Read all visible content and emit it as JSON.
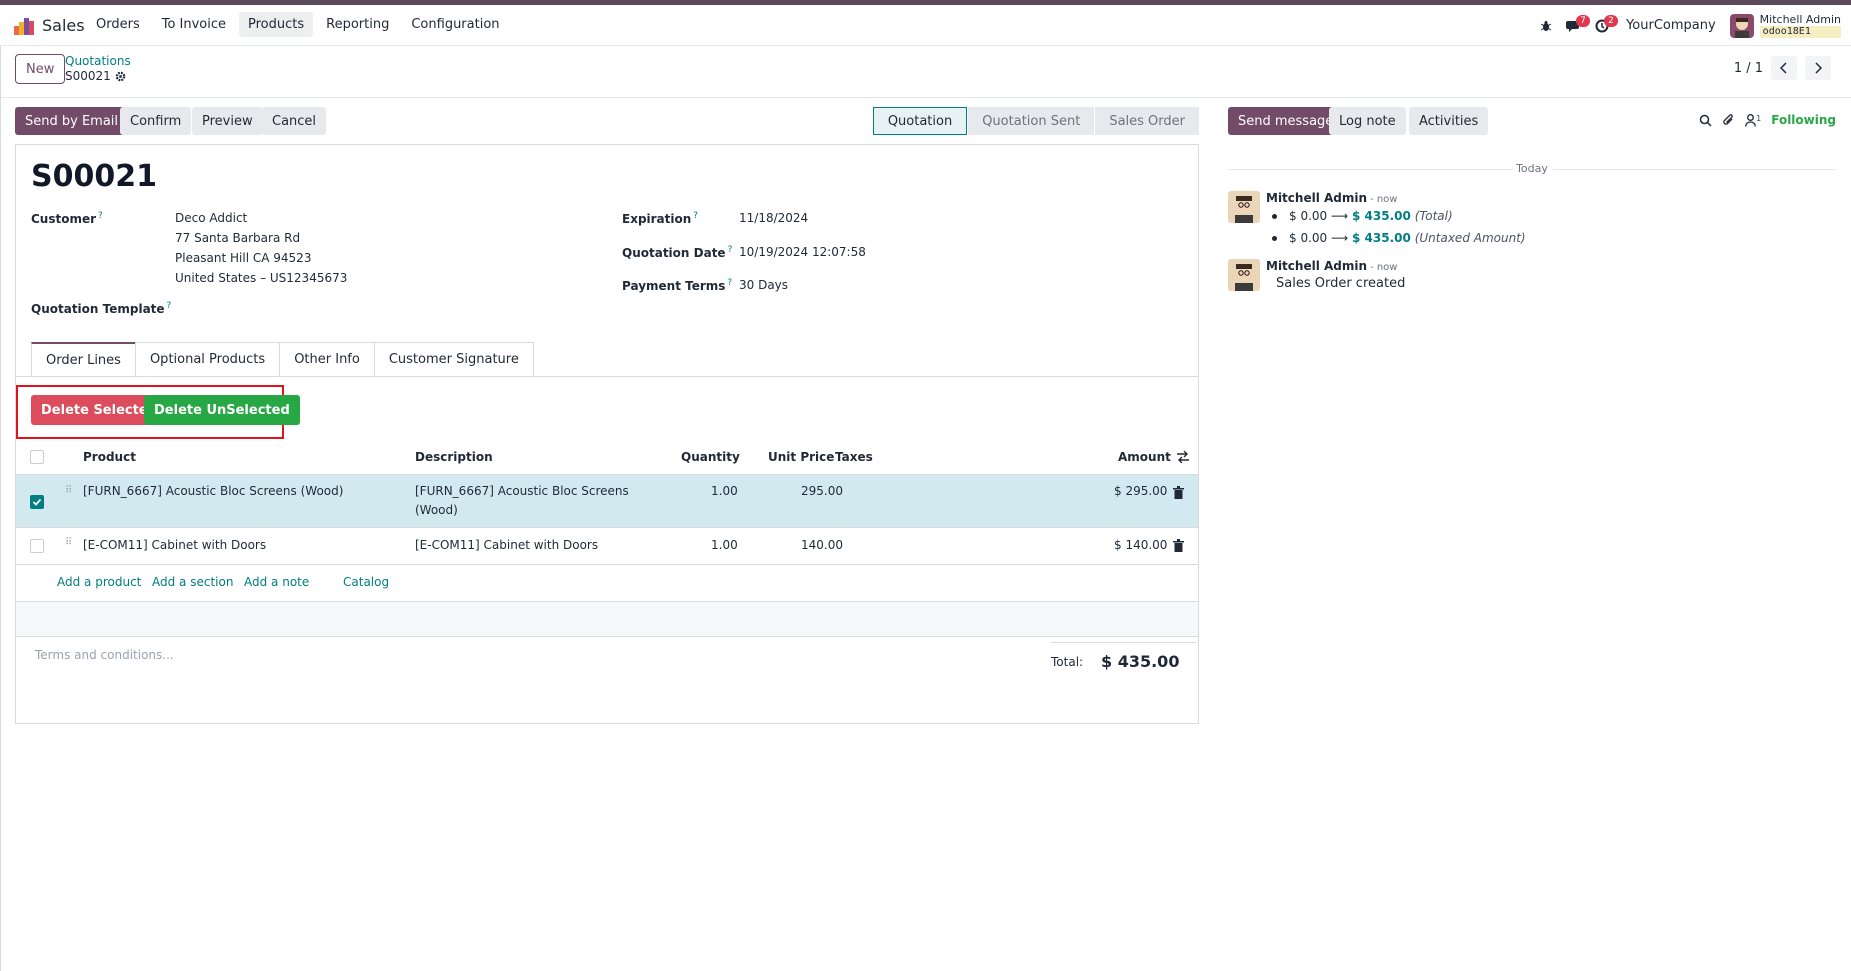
{
  "nav": {
    "app_name": "Sales",
    "menu": [
      "Orders",
      "To Invoice",
      "Products",
      "Reporting",
      "Configuration"
    ],
    "active_menu": "Products",
    "messages_badge": "7",
    "activities_badge": "2",
    "company": "YourCompany",
    "user_name": "Mitchell Admin",
    "db_name": "odoo18E1"
  },
  "control": {
    "new_label": "New",
    "breadcrumb": "Quotations",
    "record": "S00021",
    "pager": "1 / 1"
  },
  "actions": {
    "send_email": "Send by Email",
    "confirm": "Confirm",
    "preview": "Preview",
    "cancel": "Cancel"
  },
  "stages": [
    "Quotation",
    "Quotation Sent",
    "Sales Order"
  ],
  "form": {
    "title": "S00021",
    "customer_label": "Customer",
    "customer_lines": [
      "Deco Addict",
      "77 Santa Barbara Rd",
      "Pleasant Hill CA 94523",
      "United States – US12345673"
    ],
    "template_label": "Quotation Template",
    "expiration_label": "Expiration",
    "expiration": "11/18/2024",
    "quotation_date_label": "Quotation Date",
    "quotation_date": "10/19/2024 12:07:58",
    "payment_terms_label": "Payment Terms",
    "payment_terms": "30 Days",
    "help_mark": "?"
  },
  "tabs": [
    "Order Lines",
    "Optional Products",
    "Other Info",
    "Customer Signature"
  ],
  "delete_selected": "Delete Selected",
  "delete_unselected": "Delete UnSelected",
  "table": {
    "headers": {
      "product": "Product",
      "description": "Description",
      "quantity": "Quantity",
      "unit_price": "Unit Price",
      "taxes": "Taxes",
      "amount": "Amount"
    },
    "rows": [
      {
        "product": "[FURN_6667] Acoustic Bloc Screens (Wood)",
        "description_1": "[FURN_6667] Acoustic Bloc Screens",
        "description_2": "(Wood)",
        "quantity": "1.00",
        "unit_price": "295.00",
        "amount": "$ 295.00",
        "selected": true
      },
      {
        "product": "[E-COM11] Cabinet with Doors",
        "description_1": "[E-COM11] Cabinet with Doors",
        "description_2": "",
        "quantity": "1.00",
        "unit_price": "140.00",
        "amount": "$ 140.00",
        "selected": false
      }
    ],
    "add_product": "Add a product",
    "add_section": "Add a section",
    "add_note": "Add a note",
    "catalog": "Catalog"
  },
  "terms_placeholder": "Terms and conditions...",
  "total_label": "Total:",
  "total_value": "$ 435.00",
  "chatter": {
    "send_message": "Send message",
    "log_note": "Log note",
    "activities": "Activities",
    "followers_count": "1",
    "following": "Following",
    "today": "Today",
    "messages": [
      {
        "author": "Mitchell Admin",
        "when": "- now",
        "tracking": [
          {
            "old": "$ 0.00",
            "new": "$ 435.00",
            "field": "(Total)"
          },
          {
            "old": "$ 0.00",
            "new": "$ 435.00",
            "field": "(Untaxed Amount)"
          }
        ]
      },
      {
        "author": "Mitchell Admin",
        "when": "- now",
        "body": "Sales Order created"
      }
    ]
  },
  "colors": {
    "brand": "#714b67",
    "teal": "#017e84",
    "danger": "#dc4c5c",
    "success": "#28a745"
  }
}
